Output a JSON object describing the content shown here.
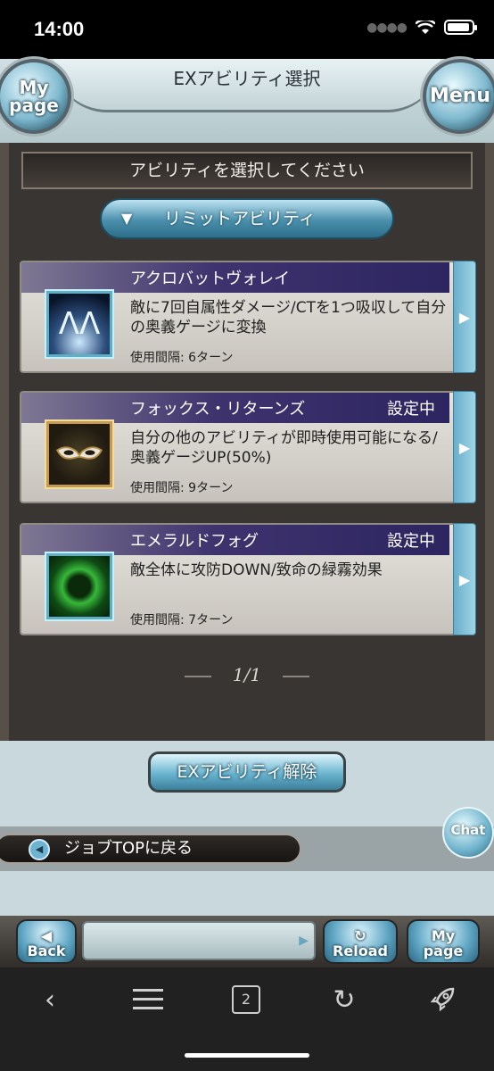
{
  "status_bar": {
    "time": "14:00"
  },
  "header": {
    "title": "EXアビリティ選択",
    "mypage_label_line1": "My",
    "mypage_label_line2": "page",
    "menu_label": "Menu"
  },
  "panel": {
    "prompt": "アビリティを選択してください",
    "category_label": "リミットアビリティ",
    "abilities": [
      {
        "name": "アクロバットヴォレイ",
        "status": "",
        "description": "敵に7回自属性ダメージ/CTを1つ吸収して自分の奥義ゲージに変換",
        "interval": "使用間隔: 6ターン",
        "icon": "acrobat-volley-icon"
      },
      {
        "name": "フォックス・リターンズ",
        "status": "設定中",
        "description": "自分の他のアビリティが即時使用可能になる/奥義ゲージUP(50%)",
        "interval": "使用間隔: 9ターン",
        "icon": "fox-mask-icon"
      },
      {
        "name": "エメラルドフォグ",
        "status": "設定中",
        "description": "敵全体に攻防DOWN/致命の緑霧効果",
        "interval": "使用間隔: 7ターン",
        "icon": "emerald-fog-icon"
      }
    ],
    "pager": "1/1"
  },
  "release_button": "EXアビリティ解除",
  "job_top_button": "ジョブTOPに戻る",
  "chat_label": "Chat",
  "game_nav": {
    "back": "Back",
    "reload": "Reload",
    "mypage_line1": "My",
    "mypage_line2": "page"
  },
  "browser_bar": {
    "tab_count": "2"
  },
  "colors": {
    "panel_bg": "#383533",
    "ability_header": "#2c2560",
    "accent_blue": "#6ab4cf"
  }
}
